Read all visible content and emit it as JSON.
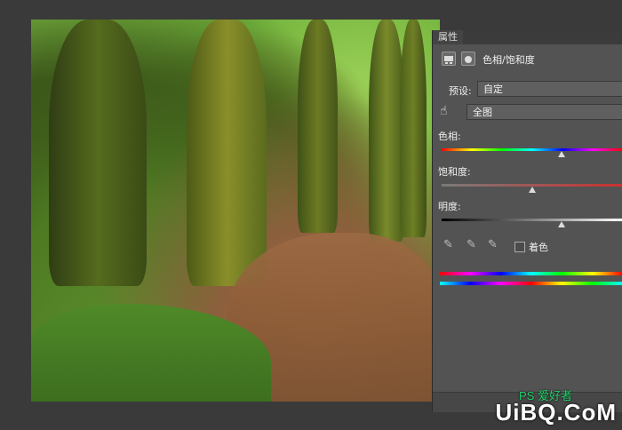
{
  "panel": {
    "tab_label": "属性",
    "adjustment_title": "色相/饱和度",
    "preset_label": "预设:",
    "preset_value": "自定",
    "channel_value": "全图",
    "hue_label": "色相:",
    "saturation_label": "饱和度:",
    "lightness_label": "明度:",
    "colorize_label": "着色",
    "hue_level": 0.66,
    "saturation_level": 0.5,
    "lightness_level": 0.66,
    "colorize_checked": false
  },
  "watermark": {
    "text": "UiBQ.CoM",
    "small_text": "PS 爱好者"
  },
  "colors": {
    "panel_bg": "#535353",
    "workspace_bg": "#3a3a3a",
    "hue_track": "#ff0000",
    "saturation_track": "#c8322f"
  }
}
